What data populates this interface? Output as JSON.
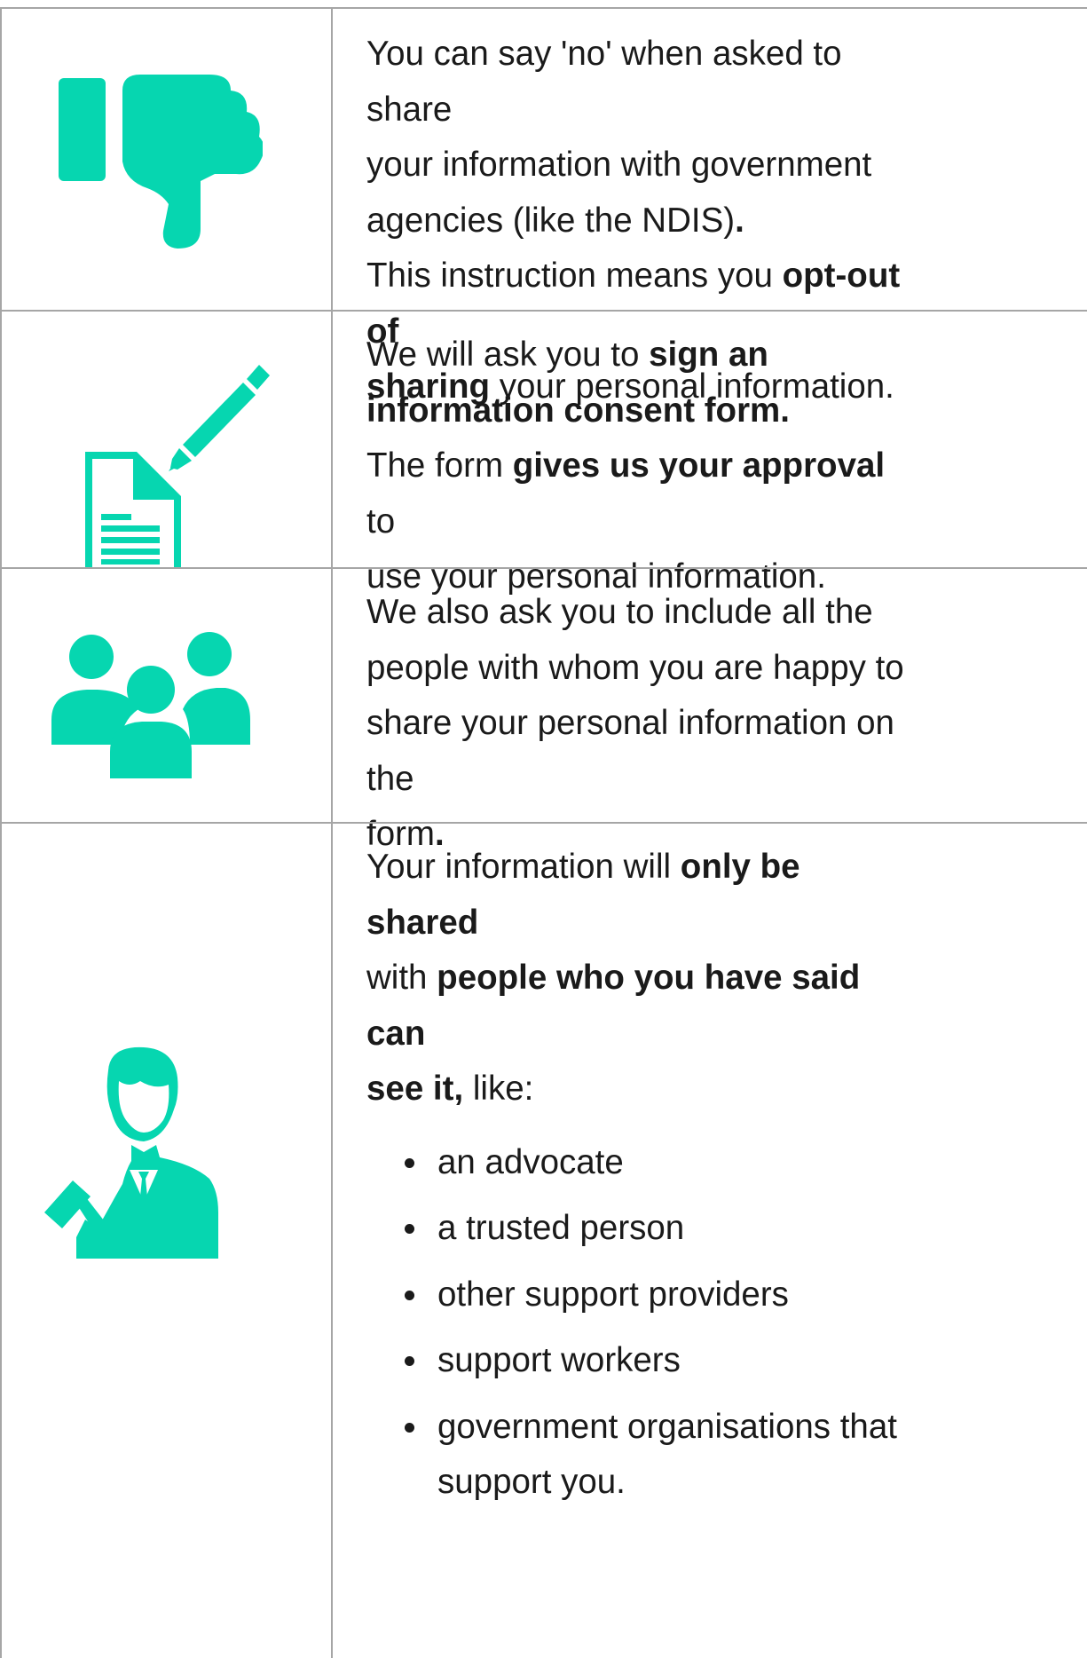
{
  "colors": {
    "accent": "#06D6B0",
    "border": "#A6A6A6",
    "text": "#1A1A1A"
  },
  "rows": [
    {
      "icon": "thumbs-down-icon",
      "lines": [
        [
          {
            "t": "You can say 'no' when asked to share",
            "b": false
          }
        ],
        [
          {
            "t": "your information with government",
            "b": false
          }
        ],
        [
          {
            "t": "agencies (like the NDIS)",
            "b": false
          },
          {
            "t": ".",
            "b": true
          }
        ],
        [
          {
            "t": "This instruction means you ",
            "b": false
          },
          {
            "t": "opt-out of",
            "b": true
          }
        ],
        [
          {
            "t": "sharing",
            "b": true
          },
          {
            "t": " your personal information.",
            "b": false
          }
        ]
      ]
    },
    {
      "icon": "sign-document-icon",
      "lines": [
        [
          {
            "t": "We will ask you to ",
            "b": false
          },
          {
            "t": "sign an",
            "b": true
          }
        ],
        [
          {
            "t": "information consent form.",
            "b": true
          }
        ],
        [
          {
            "t": "The form ",
            "b": false
          },
          {
            "t": "gives us your approval",
            "b": true
          },
          {
            "t": " to",
            "b": false
          }
        ],
        [
          {
            "t": "use your personal information.",
            "b": false
          }
        ]
      ]
    },
    {
      "icon": "group-people-icon",
      "lines": [
        [
          {
            "t": "We also ask you to include all the",
            "b": false
          }
        ],
        [
          {
            "t": "people with whom you are happy to",
            "b": false
          }
        ],
        [
          {
            "t": "share your personal information on the",
            "b": false
          }
        ],
        [
          {
            "t": "form",
            "b": false
          },
          {
            "t": ".",
            "b": true
          }
        ]
      ]
    },
    {
      "icon": "advocate-person-icon",
      "lines": [
        [
          {
            "t": "Your information will ",
            "b": false
          },
          {
            "t": "only be shared",
            "b": true
          }
        ],
        [
          {
            "t": "with ",
            "b": false
          },
          {
            "t": "people who you have said can",
            "b": true
          }
        ],
        [
          {
            "t": "see it,",
            "b": true
          },
          {
            "t": " like:",
            "b": false
          }
        ]
      ],
      "bullets": [
        "an advocate",
        "a trusted person",
        "other support providers",
        "support workers",
        "government organisations that support you."
      ]
    }
  ]
}
